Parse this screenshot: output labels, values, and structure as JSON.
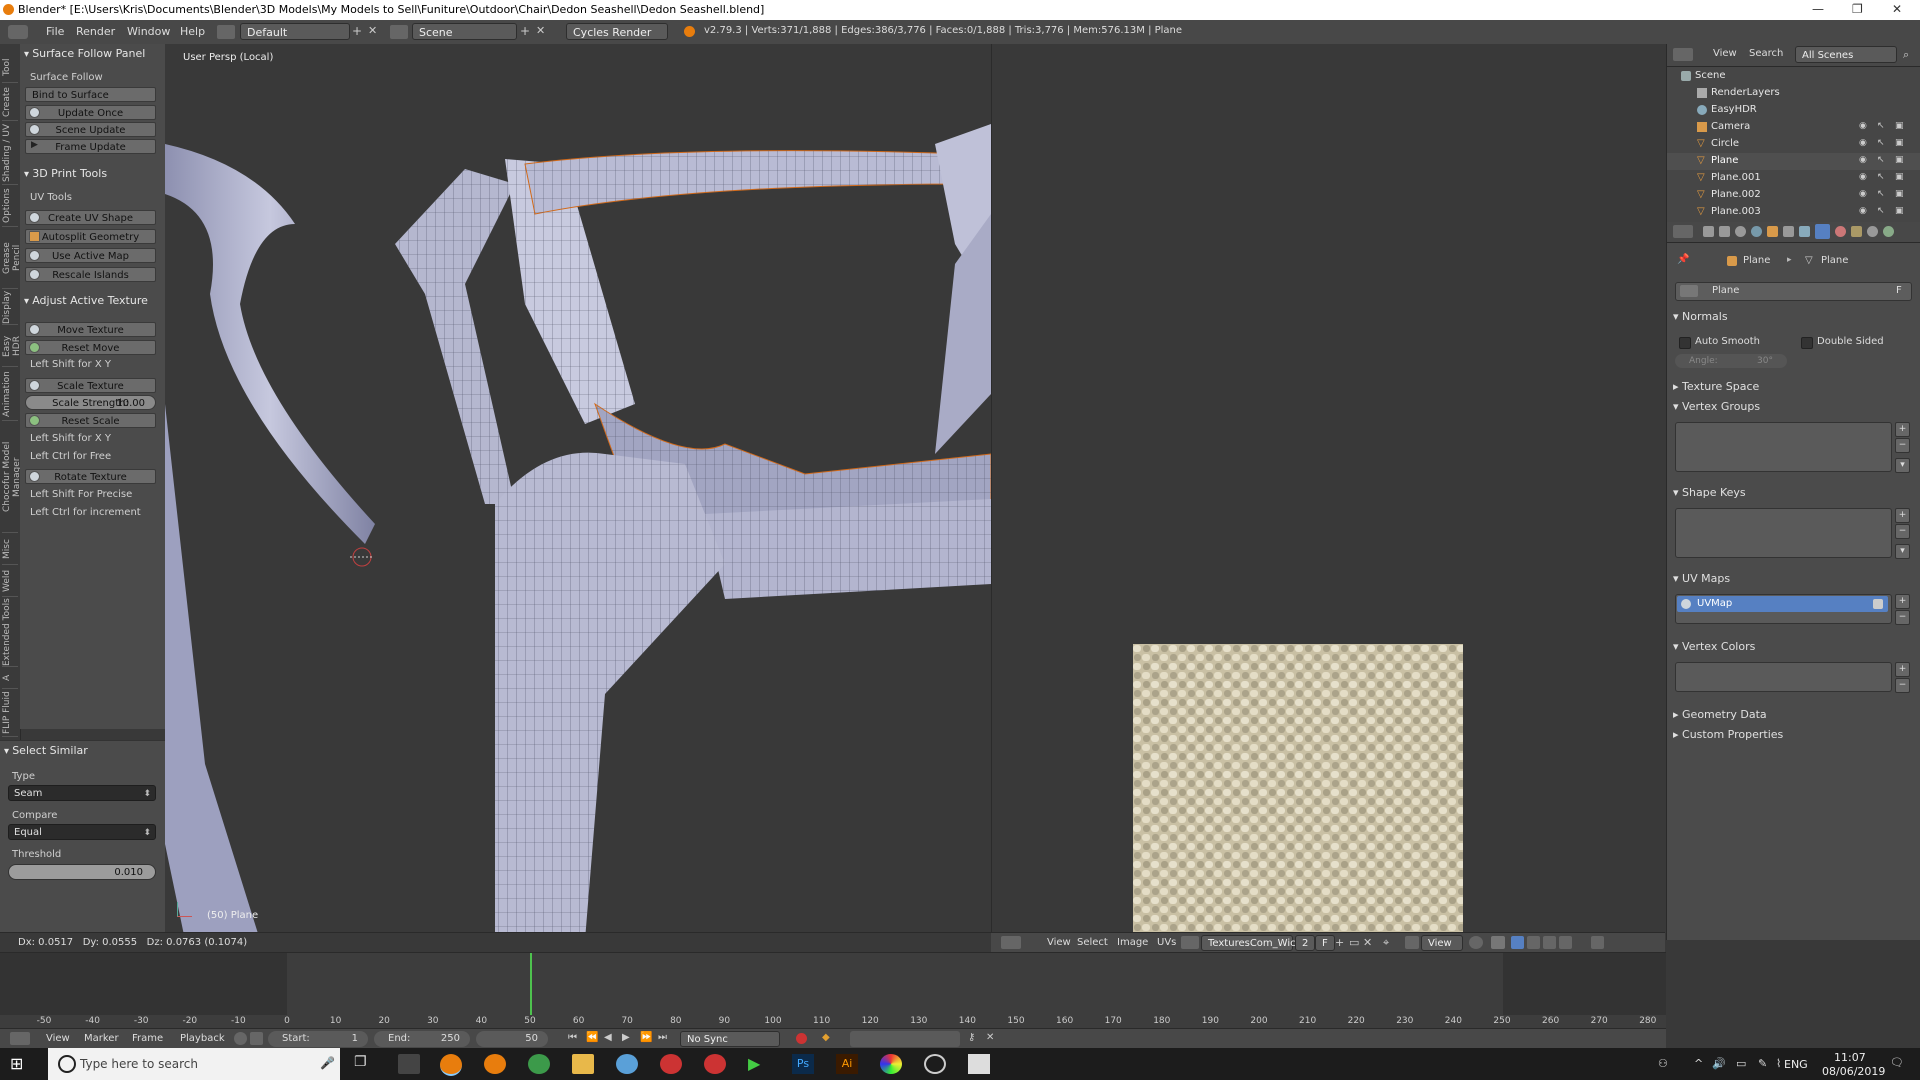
{
  "window": {
    "title": "Blender* [E:\\Users\\Kris\\Documents\\Blender\\3D Models\\My Models to Sell\\Funiture\\Outdoor\\Chair\\Dedon Seashell\\Dedon Seashell.blend]"
  },
  "infobar": {
    "menus": [
      "File",
      "Render",
      "Window",
      "Help"
    ],
    "layout": "Default",
    "scene": "Scene",
    "engine": "Cycles Render",
    "stats": "v2.79.3 | Verts:371/1,888 | Edges:386/3,776 | Faces:0/1,888 | Tris:3,776 | Mem:576.13M | Plane"
  },
  "vtabs": [
    "Tool",
    "Create",
    "Shading / UV",
    "Options",
    "Grease Pencil",
    "Display",
    "Easy HDR",
    "Animation",
    "Chocofur Model Manager",
    "Misc",
    "Weld",
    "Extended Tools",
    "A",
    "FLIP Fluid"
  ],
  "toolshelf": {
    "surface_follow": {
      "title": "Surface Follow Panel",
      "label": "Surface Follow",
      "bind_btn": "Bind to Surface",
      "update_once": "Update Once",
      "scene_update": "Scene Update",
      "frame_update": "Frame Update"
    },
    "print_tools": {
      "title": "3D Print Tools",
      "label": "UV Tools",
      "create_uv": "Create UV Shape",
      "autosplit": "Autosplit Geometry",
      "use_active": "Use Active Map",
      "rescale": "Rescale Islands"
    },
    "adjust": {
      "title": "Adjust Active Texture",
      "move": "Move Texture",
      "reset_move": "Reset Move",
      "hint1": "Left Shift for X Y",
      "scale": "Scale Texture",
      "strength_label": "Scale Strength:",
      "strength_value": "10.00",
      "reset_scale": "Reset Scale",
      "hint2": "Left Shift for X Y",
      "hint3": "Left Ctrl for Free",
      "rotate": "Rotate Texture",
      "hint4": "Left Shift For Precise",
      "hint5": "Left Ctrl for increment"
    }
  },
  "select_similar": {
    "title": "Select Similar",
    "type_label": "Type",
    "type_value": "Seam",
    "compare_label": "Compare",
    "compare_value": "Equal",
    "threshold_label": "Threshold",
    "threshold_value": "0.010"
  },
  "viewport": {
    "view_label": "User Persp (Local)",
    "object_label": "(50) Plane",
    "status": "Dx: 0.0517   Dy: 0.0555   Dz: 0.0763 (0.1074)"
  },
  "uv_header": {
    "menus": [
      "View",
      "Select",
      "Image",
      "UVs"
    ],
    "image": "TexturesCom_Wic...",
    "users": "2",
    "fake": "F",
    "view": "View"
  },
  "outliner": {
    "view": "View",
    "search": "Search",
    "scenes": "All Scenes",
    "items": [
      "Scene",
      "RenderLayers",
      "EasyHDR",
      "Camera",
      "Circle",
      "Plane",
      "Plane.001",
      "Plane.002",
      "Plane.003"
    ]
  },
  "properties": {
    "breadcrumb_obj": "Plane",
    "breadcrumb_mesh": "Plane",
    "mesh_name": "Plane",
    "fake_btn": "F",
    "normals": "Normals",
    "auto_smooth": "Auto Smooth",
    "double_sided": "Double Sided",
    "angle_label": "Angle:",
    "angle_value": "30°",
    "texture_space": "Texture Space",
    "vertex_groups": "Vertex Groups",
    "shape_keys": "Shape Keys",
    "uv_maps": "UV Maps",
    "uvmap_item": "UVMap",
    "vertex_colors": "Vertex Colors",
    "geometry_data": "Geometry Data",
    "custom_props": "Custom Properties"
  },
  "timeline": {
    "ticks": [
      "-50",
      "-40",
      "-30",
      "-20",
      "-10",
      "0",
      "10",
      "20",
      "30",
      "40",
      "50",
      "60",
      "70",
      "80",
      "90",
      "100",
      "110",
      "120",
      "130",
      "140",
      "150",
      "160",
      "170",
      "180",
      "190",
      "200",
      "210",
      "220",
      "230",
      "240",
      "250",
      "260",
      "270",
      "280"
    ],
    "current_frame_value": 50,
    "menus": [
      "View",
      "Marker",
      "Frame",
      "Playback"
    ],
    "start": "Start:",
    "start_value": "1",
    "end": "End:",
    "end_value": "250",
    "frame_value": "50",
    "sync": "No Sync"
  },
  "taskbar": {
    "search_placeholder": "Type here to search",
    "lang": "ENG",
    "time": "11:07",
    "date": "08/06/2019"
  }
}
